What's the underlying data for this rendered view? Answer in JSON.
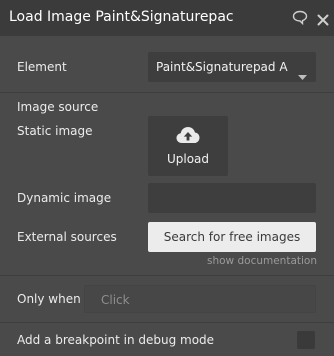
{
  "header": {
    "title": "Load Image Paint&Signaturepac",
    "comment_icon": "comment-icon",
    "close_icon": "close-icon"
  },
  "fields": {
    "element_label": "Element",
    "element_value": "Paint&Signaturepad A",
    "image_source_label": "Image source",
    "static_image_label": "Static image",
    "upload_label": "Upload",
    "dynamic_image_label": "Dynamic image",
    "dynamic_image_value": "",
    "external_sources_label": "External sources",
    "search_button_label": "Search for free images",
    "show_documentation": "show documentation"
  },
  "only_when": {
    "label": "Only when",
    "placeholder": "Click"
  },
  "breakpoint": {
    "label": "Add a breakpoint in debug mode",
    "checked": false
  },
  "colors": {
    "panel_bg": "#4a4a4a",
    "header_bg": "#3b3b3b",
    "field_bg": "#3e3e3e",
    "button_bg": "#ececec"
  }
}
